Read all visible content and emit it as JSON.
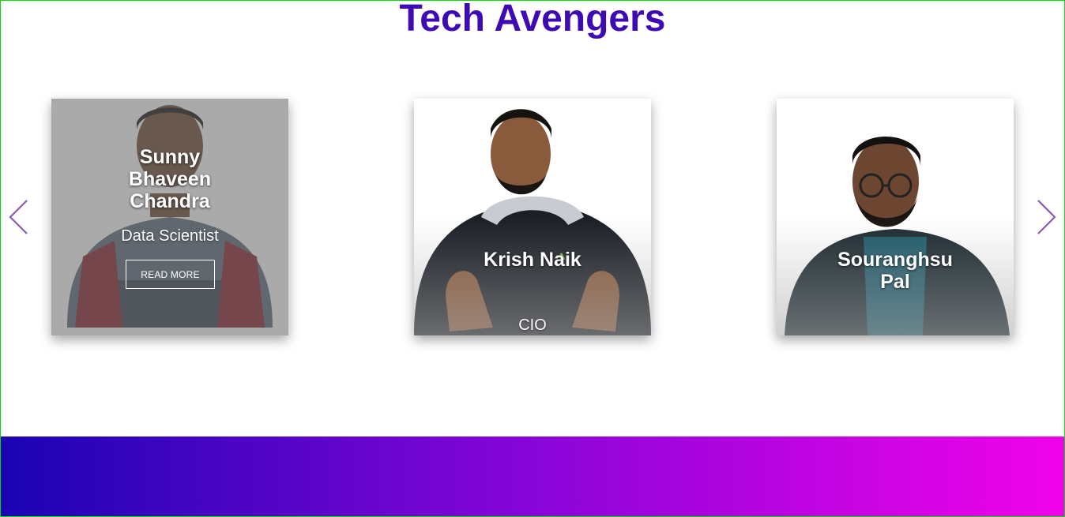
{
  "page": {
    "title": "Tech Avengers"
  },
  "carousel": {
    "prev_icon": "chevron-left-icon",
    "next_icon": "chevron-right-icon",
    "arrow_color": "#8a5bb0",
    "cards": [
      {
        "name": "Sunny Bhaveen Chandra",
        "role": "Data Scientist",
        "button_label": "READ MORE"
      },
      {
        "name": "Krish Naik",
        "role": "CIO"
      },
      {
        "name": "Souranghsu Pal"
      }
    ]
  },
  "colors": {
    "title": "#3e0ab4",
    "footer_gradient_start": "#1a03b4",
    "footer_gradient_end": "#f103ea",
    "frame_border": "#00e000"
  }
}
